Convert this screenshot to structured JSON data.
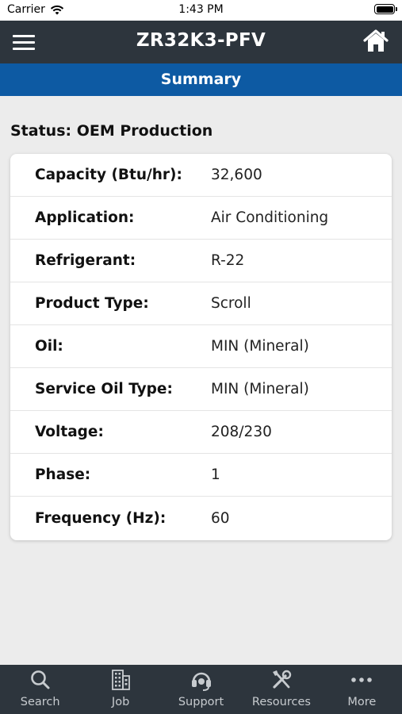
{
  "status_bar": {
    "carrier": "Carrier",
    "time": "1:43 PM"
  },
  "header": {
    "title": "ZR32K3-PFV"
  },
  "section": {
    "title": "Summary"
  },
  "status": {
    "text": "Status: OEM Production"
  },
  "specs": [
    {
      "label": "Capacity (Btu/hr):",
      "value": "32,600"
    },
    {
      "label": "Application:",
      "value": "Air Conditioning"
    },
    {
      "label": "Refrigerant:",
      "value": "R-22"
    },
    {
      "label": "Product Type:",
      "value": "Scroll"
    },
    {
      "label": "Oil:",
      "value": "MIN (Mineral)"
    },
    {
      "label": "Service Oil Type:",
      "value": "MIN (Mineral)"
    },
    {
      "label": "Voltage:",
      "value": "208/230"
    },
    {
      "label": "Phase:",
      "value": "1"
    },
    {
      "label": "Frequency (Hz):",
      "value": "60"
    }
  ],
  "tabs": [
    {
      "label": "Search",
      "icon": "search-icon"
    },
    {
      "label": "Job",
      "icon": "building-icon"
    },
    {
      "label": "Support",
      "icon": "headset-icon"
    },
    {
      "label": "Resources",
      "icon": "tools-icon"
    },
    {
      "label": "More",
      "icon": "more-icon"
    }
  ],
  "colors": {
    "header": "#2d353d",
    "summary_bar": "#0d5aa3",
    "background": "#ececec"
  }
}
